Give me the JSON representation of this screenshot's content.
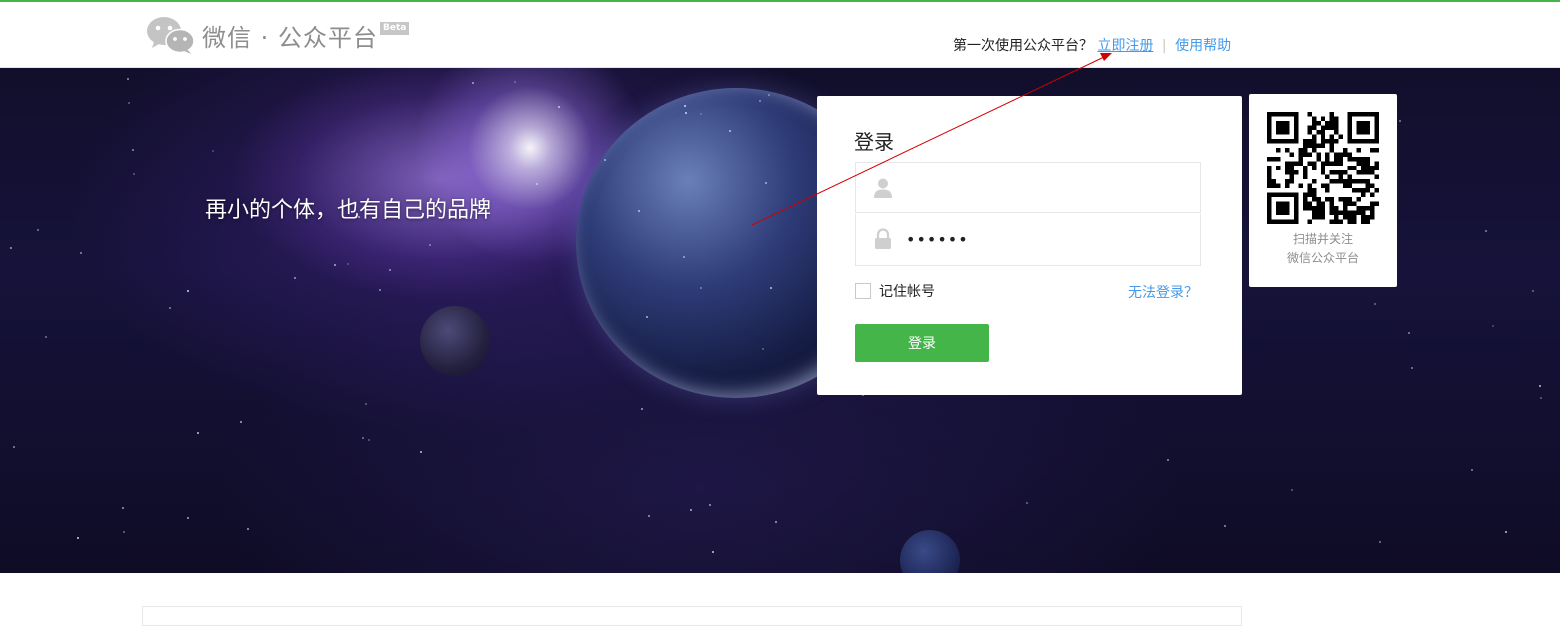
{
  "header": {
    "logo_text": "微信 · 公众平台",
    "beta_badge": "Beta",
    "first_time_prompt": "第一次使用公众平台？",
    "register_link": "立即注册",
    "separator": "|",
    "help_link": "使用帮助"
  },
  "banner": {
    "slogan": "再小的个体，也有自己的品牌"
  },
  "login": {
    "title": "登录",
    "username_value": "",
    "password_value": "••••••",
    "remember_label": "记住帐号",
    "forgot_link": "无法登录？",
    "submit_label": "登录"
  },
  "qr": {
    "caption_line1": "扫描并关注",
    "caption_line2": "微信公众平台"
  },
  "colors": {
    "brand_green": "#44b549",
    "link_blue": "#459ae9",
    "annotation_red": "#d20000"
  },
  "icons": [
    "wechat-logo-icon",
    "user-icon",
    "lock-icon",
    "qr-code-icon"
  ]
}
